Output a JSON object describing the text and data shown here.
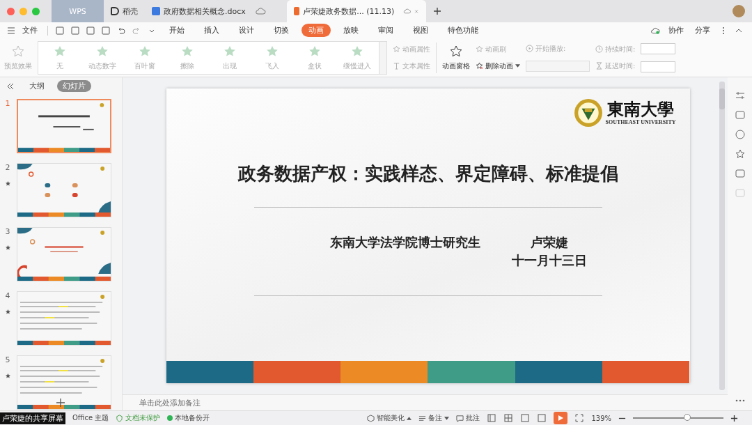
{
  "title_bar": {
    "tabs": [
      {
        "kind": "home",
        "label": "WPS",
        "selected": false
      },
      {
        "kind": "daoke",
        "label": "稻壳",
        "selected": false
      },
      {
        "kind": "doc",
        "label": "政府数据相关概念.docx",
        "selected": false
      },
      {
        "kind": "ppt",
        "label": "卢荣婕政务数据... (11.13)",
        "selected": true
      }
    ]
  },
  "menu": {
    "file": "文件",
    "tabs": [
      {
        "label": "开始",
        "selected": false
      },
      {
        "label": "插入",
        "selected": false
      },
      {
        "label": "设计",
        "selected": false
      },
      {
        "label": "切换",
        "selected": false
      },
      {
        "label": "动画",
        "selected": true
      },
      {
        "label": "放映",
        "selected": false
      },
      {
        "label": "审阅",
        "selected": false
      },
      {
        "label": "视图",
        "selected": false
      },
      {
        "label": "特色功能",
        "selected": false
      }
    ],
    "collab": "协作",
    "share": "分享"
  },
  "ribbon": {
    "preview": "预览效果",
    "effects": [
      "无",
      "动态数字",
      "百叶窗",
      "擦除",
      "出现",
      "飞入",
      "盒状",
      "缓慢进入"
    ],
    "anim_props": "动画属性",
    "text_props": "文本属性",
    "pane": "动画窗格",
    "brush": {
      "label": "动画刷",
      "disabled": true
    },
    "delete": {
      "label": "删除动画",
      "disabled": false
    },
    "start": {
      "label": "开始播放:",
      "disabled": true
    },
    "duration": {
      "label": "持续时间:",
      "disabled": true
    },
    "delay": {
      "label": "延迟时间:",
      "disabled": true
    }
  },
  "panel": {
    "views": [
      {
        "label": "大纲",
        "selected": false
      },
      {
        "label": "幻灯片",
        "selected": true
      }
    ],
    "slides": [
      {
        "number": "1",
        "kind": "title",
        "selected": true,
        "animated": false
      },
      {
        "number": "2",
        "kind": "toc",
        "selected": false,
        "animated": true
      },
      {
        "number": "3",
        "kind": "section",
        "selected": false,
        "animated": true
      },
      {
        "number": "4",
        "kind": "text",
        "selected": false,
        "animated": true
      },
      {
        "number": "5",
        "kind": "text",
        "selected": false,
        "animated": true
      }
    ]
  },
  "slide": {
    "logo_name": "東南大學",
    "logo_en": "SOUTHEAST UNIVERSITY",
    "title": "政务数据产权：实践样态、界定障碍、标准提倡",
    "author_org": "东南大学法学院博士研究生",
    "author": "卢荣婕",
    "date": "十一月十三日",
    "stripes": [
      {
        "color": "#1d6a86"
      },
      {
        "color": "#e2592f"
      },
      {
        "color": "#ec8b25"
      },
      {
        "color": "#3e9c87"
      },
      {
        "color": "#1d6a86"
      },
      {
        "color": "#e2592f"
      }
    ]
  },
  "notes": {
    "placeholder": "单击此处添加备注"
  },
  "status_bar": {
    "share_label": "卢荣婕的共享屏幕",
    "theme": "Office 主题",
    "protect": "文档未保护",
    "backup": "本地备份开",
    "beautify": "智能美化",
    "notes": "备注",
    "comment": "批注",
    "zoom": "139%",
    "zoom_level": {
      "level": 0.6
    }
  }
}
